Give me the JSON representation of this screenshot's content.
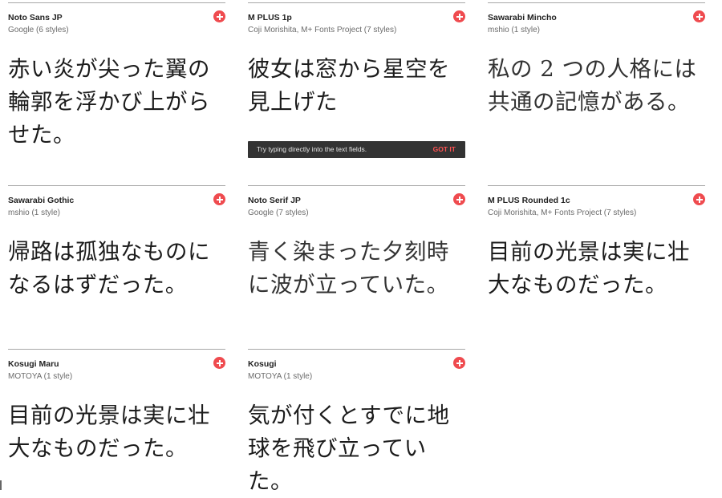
{
  "accent_color": "#ef4b4f",
  "fonts": [
    {
      "name": "Noto Sans JP",
      "author": "Google (6 styles)",
      "sample": "赤い炎が尖った翼の輪郭を浮かび上がらせた。",
      "add_icon": "plus-circle-icon"
    },
    {
      "name": "M PLUS 1p",
      "author": "Coji Morishita, M+ Fonts Project (7 styles)",
      "sample": "彼女は窓から星空を見上げた",
      "add_icon": "plus-circle-icon"
    },
    {
      "name": "Sawarabi Mincho",
      "author": "mshio (1 style)",
      "sample": "私の 2 つの人格には共通の記憶がある。",
      "add_icon": "plus-circle-icon"
    },
    {
      "name": "Sawarabi Gothic",
      "author": "mshio (1 style)",
      "sample": "帰路は孤独なものになるはずだった。",
      "add_icon": "plus-circle-icon"
    },
    {
      "name": "Noto Serif JP",
      "author": "Google (7 styles)",
      "sample": "青く染まった夕刻時に波が立っていた。",
      "add_icon": "plus-circle-icon"
    },
    {
      "name": "M PLUS Rounded 1c",
      "author": "Coji Morishita, M+ Fonts Project (7 styles)",
      "sample": "目前の光景は実に壮大なものだった。",
      "add_icon": "plus-circle-icon"
    },
    {
      "name": "Kosugi Maru",
      "author": "MOTOYA (1 style)",
      "sample": "目前の光景は実に壮大なものだった。",
      "add_icon": "plus-circle-icon"
    },
    {
      "name": "Kosugi",
      "author": "MOTOYA (1 style)",
      "sample": "気が付くとすでに地球を飛び立っていた。",
      "add_icon": "plus-circle-icon"
    }
  ],
  "toast": {
    "message": "Try typing directly into the text fields.",
    "action": "GOT IT"
  }
}
